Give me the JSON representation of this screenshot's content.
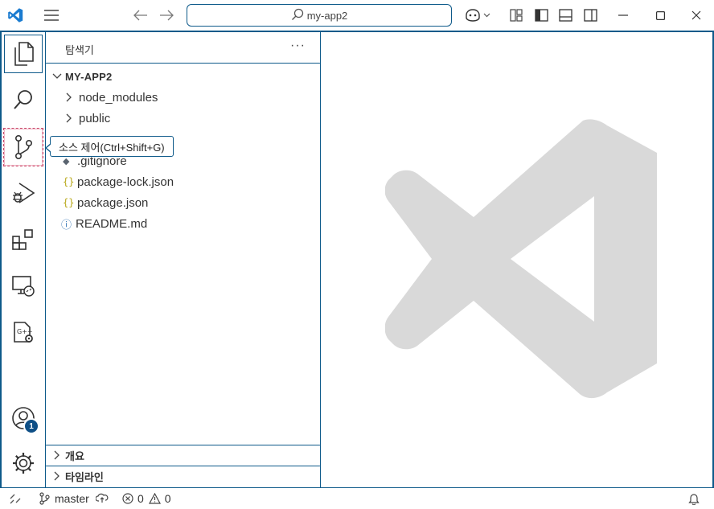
{
  "titlebar": {
    "search_text": "my-app2",
    "icons": [
      "vscode-logo-icon",
      "menu-icon",
      "back-arrow-icon",
      "forward-arrow-icon",
      "search-icon",
      "copilot-icon",
      "customize-layout-icon",
      "toggle-primary-sidebar-icon",
      "toggle-panel-icon",
      "toggle-secondary-sidebar-icon",
      "minimize-icon",
      "maximize-icon",
      "close-icon"
    ]
  },
  "activity_bar": {
    "items": [
      "explorer-icon",
      "search-icon",
      "source-control-icon",
      "run-debug-icon",
      "extensions-icon",
      "remote-explorer-icon",
      "gcc-settings-icon"
    ],
    "accounts_badge": "1"
  },
  "sidebar": {
    "title": "탐색기",
    "more": "···",
    "root_folder": "MY-APP2",
    "tree": [
      {
        "label": "node_modules",
        "type": "folder"
      },
      {
        "label": "public",
        "type": "folder"
      },
      {
        "label": ".gitignore",
        "type": "git"
      },
      {
        "label": "package-lock.json",
        "type": "json"
      },
      {
        "label": "package.json",
        "type": "json"
      },
      {
        "label": "README.md",
        "type": "info"
      }
    ],
    "sections": [
      "개요",
      "타임라인"
    ]
  },
  "tooltip": {
    "text": "소스 제어(Ctrl+Shift+G)"
  },
  "statusbar": {
    "branch": "master",
    "errors": "0",
    "warnings": "0"
  },
  "colors": {
    "accent": "#0e5a8a",
    "watermark": "#d9d9d9",
    "badge": "#0e4f86"
  }
}
